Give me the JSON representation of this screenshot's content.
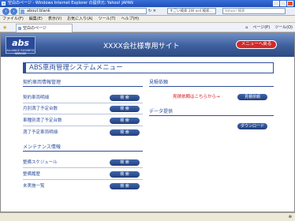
{
  "window": {
    "title": "空白のページ - Windows Internet Explorer の提供元: Yahoo! JAPAN"
  },
  "address": {
    "url": "about:blank",
    "search_hint": "すごい検索 2W ord 検索...",
    "yahoo_placeholder": "Yahoo! 検索"
  },
  "menubar": [
    "ファイル(F)",
    "編集(E)",
    "表示(V)",
    "お気に入り(A)",
    "ツール(T)",
    "ヘルプ(H)"
  ],
  "tab": {
    "label": "空白のページ"
  },
  "tools": {
    "home": "⌂",
    "page": "ページ(P)",
    "tool": "ツール(O)"
  },
  "site": {
    "logo": "abs",
    "logo_sub": "ALLIANCE BUSINESS SERVICE",
    "header_title": "XXXX会社様専用サイト",
    "menu_return": "メニューへ戻る",
    "page_title": "ABS車両管理システムメニュー"
  },
  "contract": {
    "heading": "契約車両情報管理",
    "items": [
      {
        "label": "契約車両明細",
        "button": "検 索"
      },
      {
        "label": "月別満了予定台数",
        "button": "検 索"
      },
      {
        "label": "車種別満了予定台数",
        "button": "検 索"
      },
      {
        "label": "満了予定車両明細",
        "button": "検 索"
      }
    ]
  },
  "maintenance": {
    "heading": "メンテナンス情報",
    "items": [
      {
        "label": "整備スケジュール",
        "button": "検 索"
      },
      {
        "label": "整備履歴",
        "button": "検 索"
      },
      {
        "label": "未実施一覧",
        "button": "検 索"
      }
    ]
  },
  "quote": {
    "heading": "見積依頼",
    "prompt": "見積依頼はこちらから→",
    "button": "見積依頼"
  },
  "data": {
    "heading": "データ提供",
    "button": "ダウンロード"
  },
  "colors": {
    "accent": "#2e4f9a",
    "header": "#3d5e9c",
    "red": "#d22a2a"
  }
}
